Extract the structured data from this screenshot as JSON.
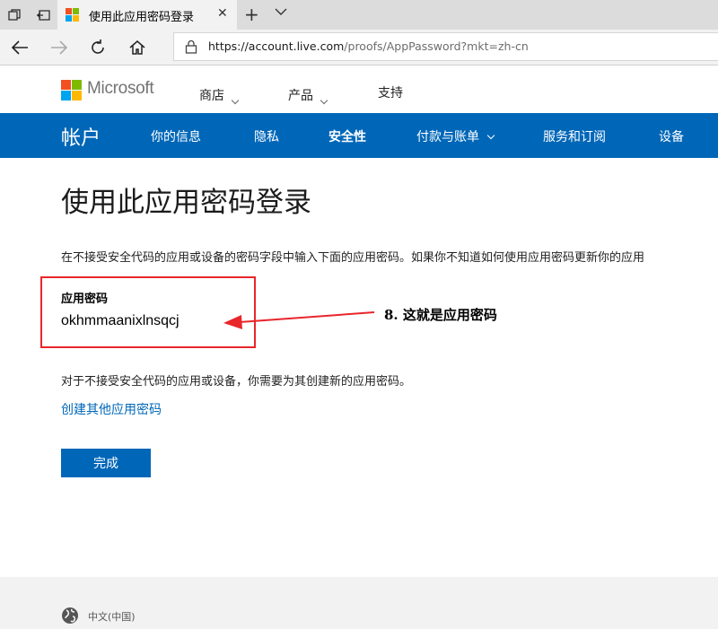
{
  "browser": {
    "tab_title": "使用此应用密码登录",
    "url_domain": "https://account.live.com",
    "url_path": "/proofs/AppPassword?mkt=zh-cn"
  },
  "header": {
    "brand": "Microsoft",
    "nav": [
      {
        "label": "商店",
        "has_dropdown": true
      },
      {
        "label": "产品",
        "has_dropdown": true
      },
      {
        "label": "支持",
        "has_dropdown": false
      }
    ]
  },
  "account_nav": {
    "title": "帐户",
    "items": [
      {
        "label": "你的信息"
      },
      {
        "label": "隐私"
      },
      {
        "label": "安全性",
        "active": true
      },
      {
        "label": "付款与账单",
        "has_dropdown": true
      },
      {
        "label": "服务和订阅"
      },
      {
        "label": "设备"
      }
    ],
    "bg_color": "#0067b8"
  },
  "main": {
    "heading": "使用此应用密码登录",
    "description": "在不接受安全代码的应用或设备的密码字段中输入下面的应用密码。如果你不知道如何使用应用密码更新你的应用",
    "password_label": "应用密码",
    "password_value": "okhmmaanixlnsqcj",
    "annotation": "8. 这就是应用密码",
    "note": "对于不接受安全代码的应用或设备，你需要为其创建新的应用密码。",
    "create_link": "创建其他应用密码",
    "done_button": "完成"
  },
  "footer": {
    "locale": "中文(中国)",
    "locale_icon": "globe-icon"
  },
  "colors": {
    "accent": "#0067b8",
    "annotation_red": "#e8262b"
  }
}
